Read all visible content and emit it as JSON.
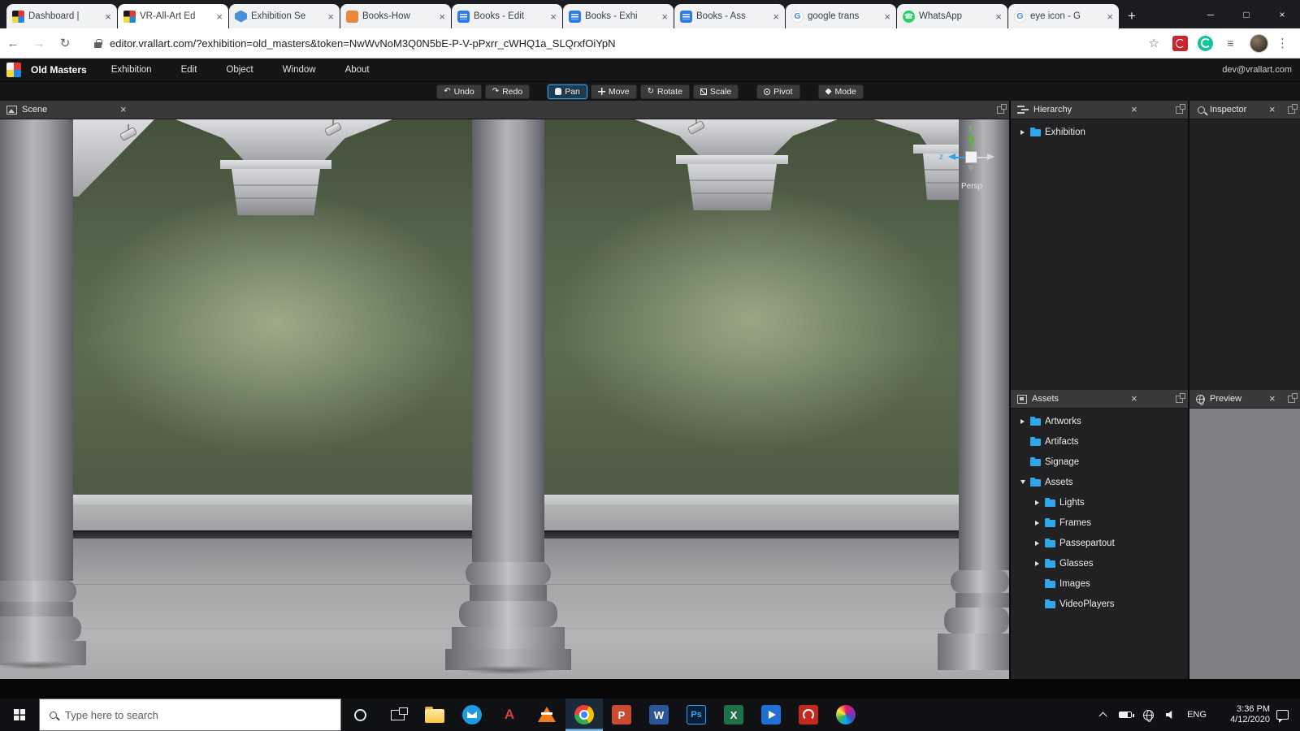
{
  "ui": {
    "close": "×",
    "back": "←",
    "forward": "→",
    "reload": "↻",
    "star": "☆",
    "dots": "⋮",
    "menu_lines": "≡",
    "plus": "+",
    "minimize": "─",
    "maximize": "□",
    "window_close": "×",
    "google_letter": "G",
    "phone_glyph": "☎",
    "glyph_undo": "↶",
    "glyph_redo": "↷"
  },
  "browser": {
    "tabs": [
      {
        "label": "Dashboard |",
        "icon": "vrallart-logo"
      },
      {
        "label": "VR-All-Art Ed",
        "icon": "vrallart-logo",
        "active": true
      },
      {
        "label": "Exhibition Se",
        "icon": "cube-3d"
      },
      {
        "label": "Books-How",
        "icon": "modeling-app"
      },
      {
        "label": "Books - Edit",
        "icon": "blue-doc"
      },
      {
        "label": "Books - Exhi",
        "icon": "blue-doc"
      },
      {
        "label": "Books - Ass",
        "icon": "blue-doc"
      },
      {
        "label": "google trans",
        "icon": "google-g"
      },
      {
        "label": "WhatsApp",
        "icon": "whatsapp"
      },
      {
        "label": "eye icon - G",
        "icon": "google-g"
      }
    ],
    "url": "editor.vrallart.com/?exhibition=old_masters&token=NwWvNoM3Q0N5bE-P-V-pPxrr_cWHQ1a_SLQrxfOiYpN"
  },
  "editor": {
    "brand": "Old Masters",
    "menu": [
      "Exhibition",
      "Edit",
      "Object",
      "Window",
      "About"
    ],
    "account": "dev@vrallart.com",
    "toolbar": {
      "undo": "Undo",
      "redo": "Redo",
      "pan": "Pan",
      "move": "Move",
      "rotate": "Rotate",
      "scale": "Scale",
      "pivot": "Pivot",
      "mode": "Mode",
      "active_tool": "Pan"
    }
  },
  "panels": {
    "scene": {
      "title": "Scene"
    },
    "hierarchy": {
      "title": "Hierarchy",
      "items": [
        {
          "label": "Exhibition"
        }
      ]
    },
    "inspector": {
      "title": "Inspector"
    },
    "assets": {
      "title": "Assets",
      "tree": [
        {
          "label": "Artworks",
          "level": 1,
          "expand": "collapsed"
        },
        {
          "label": "Artifacts",
          "level": 1,
          "expand": "none"
        },
        {
          "label": "Signage",
          "level": 1,
          "expand": "none"
        },
        {
          "label": "Assets",
          "level": 1,
          "expand": "expanded"
        },
        {
          "label": "Lights",
          "level": 2,
          "expand": "collapsed"
        },
        {
          "label": "Frames",
          "level": 2,
          "expand": "collapsed"
        },
        {
          "label": "Passepartout",
          "level": 2,
          "expand": "collapsed"
        },
        {
          "label": "Glasses",
          "level": 2,
          "expand": "collapsed"
        },
        {
          "label": "Images",
          "level": 2,
          "expand": "none"
        },
        {
          "label": "VideoPlayers",
          "level": 2,
          "expand": "none"
        }
      ]
    },
    "preview": {
      "title": "Preview"
    }
  },
  "viewport": {
    "gizmo": {
      "y_label": "y",
      "z_label": "z",
      "mode_label": "Persp"
    }
  },
  "taskbar": {
    "search_placeholder": "Type here to search",
    "apps": [
      "file-explorer",
      "mail-app",
      "autocad",
      "vlc",
      "chrome",
      "powerpoint",
      "word",
      "photoshop",
      "excel",
      "movies-app",
      "acrobat",
      "paint-3d"
    ],
    "app_glyphs": {
      "autocad": "A",
      "powerpoint": "P",
      "word": "W",
      "photoshop": "Ps",
      "excel": "X"
    },
    "tray": {
      "language": "ENG",
      "time": "3:36 PM",
      "date": "4/12/2020"
    }
  },
  "colors": {
    "accent_blue": "#2f9fe5",
    "folder_blue": "#2fa7e8",
    "wall_green": "#5b6b51",
    "tool_active_border": "#2e9fe5"
  }
}
